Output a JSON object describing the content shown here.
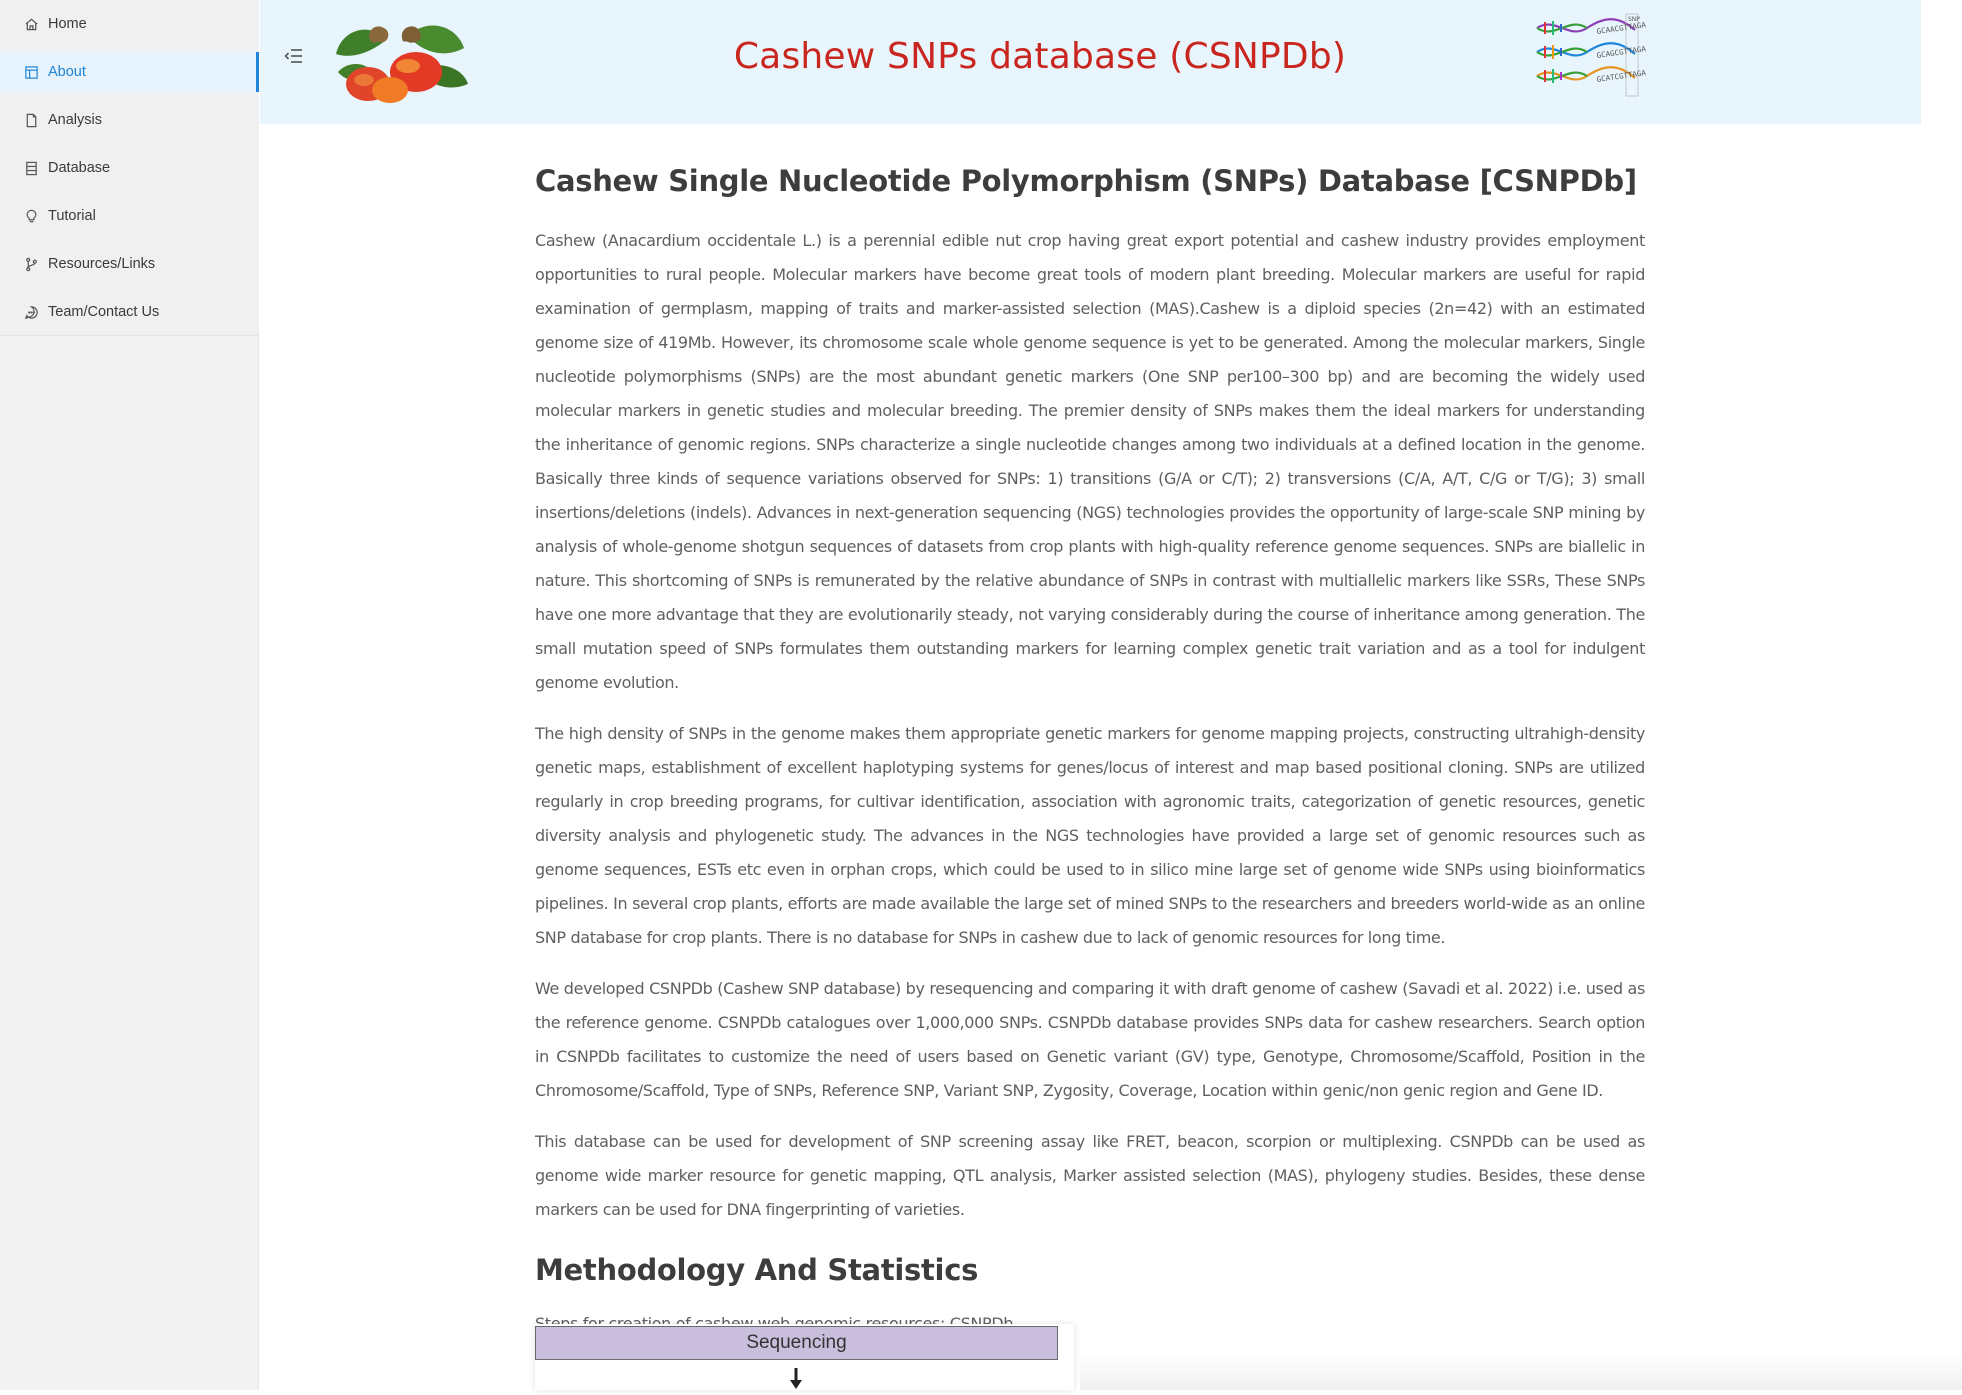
{
  "sidebar": {
    "items": [
      {
        "label": "Home",
        "icon": "home-icon"
      },
      {
        "label": "About",
        "icon": "layout-icon",
        "active": true
      },
      {
        "label": "Analysis",
        "icon": "file-icon"
      },
      {
        "label": "Database",
        "icon": "database-icon"
      },
      {
        "label": "Tutorial",
        "icon": "bulb-icon"
      },
      {
        "label": "Resources/Links",
        "icon": "branch-icon"
      },
      {
        "label": "Team/Contact Us",
        "icon": "message-icon"
      }
    ]
  },
  "header": {
    "title": "Cashew SNPs database (CSNPDb)",
    "title_color": "#c8261f",
    "background": "#e9f5fd"
  },
  "main": {
    "title": "Cashew Single Nucleotide Polymorphism (SNPs) Database [CSNPDb]",
    "paragraphs": [
      "Cashew (Anacardium occidentale L.) is a perennial edible nut crop having great export potential and cashew industry provides employment opportunities to rural people. Molecular markers have become great tools of modern plant breeding. Molecular markers are useful for rapid examination of germplasm, mapping of traits and marker-assisted selection (MAS).Cashew is a diploid species (2n=42) with an estimated genome size of 419Mb. However, its chromosome scale whole genome sequence is yet to be generated. Among the molecular markers, Single nucleotide polymorphisms (SNPs) are the most abundant genetic markers (One SNP per100–300 bp) and are becoming the widely used molecular markers in genetic studies and molecular breeding. The premier density of SNPs makes them the ideal markers for understanding the inheritance of genomic regions. SNPs characterize a single nucleotide changes among two individuals at a defined location in the genome. Basically three kinds of sequence variations observed for SNPs: 1) transitions (G/A or C/T); 2) transversions (C/A, A/T, C/G or T/G); 3) small insertions/deletions (indels). Advances in next-generation sequencing (NGS) technologies provides the opportunity of large-scale SNP mining by analysis of whole-genome shotgun sequences of datasets from crop plants with high-quality reference genome sequences. SNPs are biallelic in nature. This shortcoming of SNPs is remunerated by the relative abundance of SNPs in contrast with multiallelic markers like SSRs, These SNPs have one more advantage that they are evolutionarily steady, not varying considerably during the course of inheritance among generation. The small mutation speed of SNPs formulates them outstanding markers for learning complex genetic trait variation and as a tool for indulgent genome evolution.",
      "The high density of SNPs in the genome makes them appropriate genetic markers for genome mapping projects, constructing ultrahigh-density genetic maps, establishment of excellent haplotyping systems for genes/locus of interest and map based positional cloning. SNPs are utilized regularly in crop breeding programs, for cultivar identification, association with agronomic traits, categorization of genetic resources, genetic diversity analysis and phylogenetic study. The advances in the NGS technologies have provided a large set of genomic resources such as genome sequences, ESTs etc even in orphan crops, which could be used to in silico mine large set of genome wide SNPs using bioinformatics pipelines. In several crop plants, efforts are made available the large set of mined SNPs to the researchers and breeders world-wide as an online SNP database for crop plants. There is no database for SNPs in cashew due to lack of genomic resources for long time.",
      "We developed CSNPDb (Cashew SNP database) by resequencing and comparing it with draft genome of cashew (Savadi et al. 2022) i.e. used as the reference genome. CSNPDb catalogues over 1,000,000 SNPs. CSNPDb database provides SNPs data for cashew researchers. Search option in CSNPDb facilitates to customize the need of users based on Genetic variant (GV) type, Genotype, Chromosome/Scaffold, Position in the Chromosome/Scaffold, Type of SNPs, Reference SNP, Variant SNP, Zygosity, Coverage, Location within genic/non genic region and Gene ID.",
      "This database can be used for development of SNP screening assay like FRET, beacon, scorpion or multiplexing. CSNPDb can be used as genome wide marker resource for genetic mapping, QTL analysis, Marker assisted selection (MAS), phylogeny studies. Besides, these dense markers can be used for DNA fingerprinting of varieties."
    ],
    "methodology_title": "Methodology And Statistics",
    "methodology_caption": "Steps for creation of cashew web genomic resources: CSNPDb",
    "flow_step": "Sequencing",
    "flow_step_color": "#c9bfdc"
  },
  "logos": {
    "dna_snp_label": "SNP",
    "dna_sequences": [
      "GCAACGTTAGA",
      "GCAGCGTTAGA",
      "GCATCGTTAGA"
    ]
  },
  "accent_color": "#1f86d9"
}
